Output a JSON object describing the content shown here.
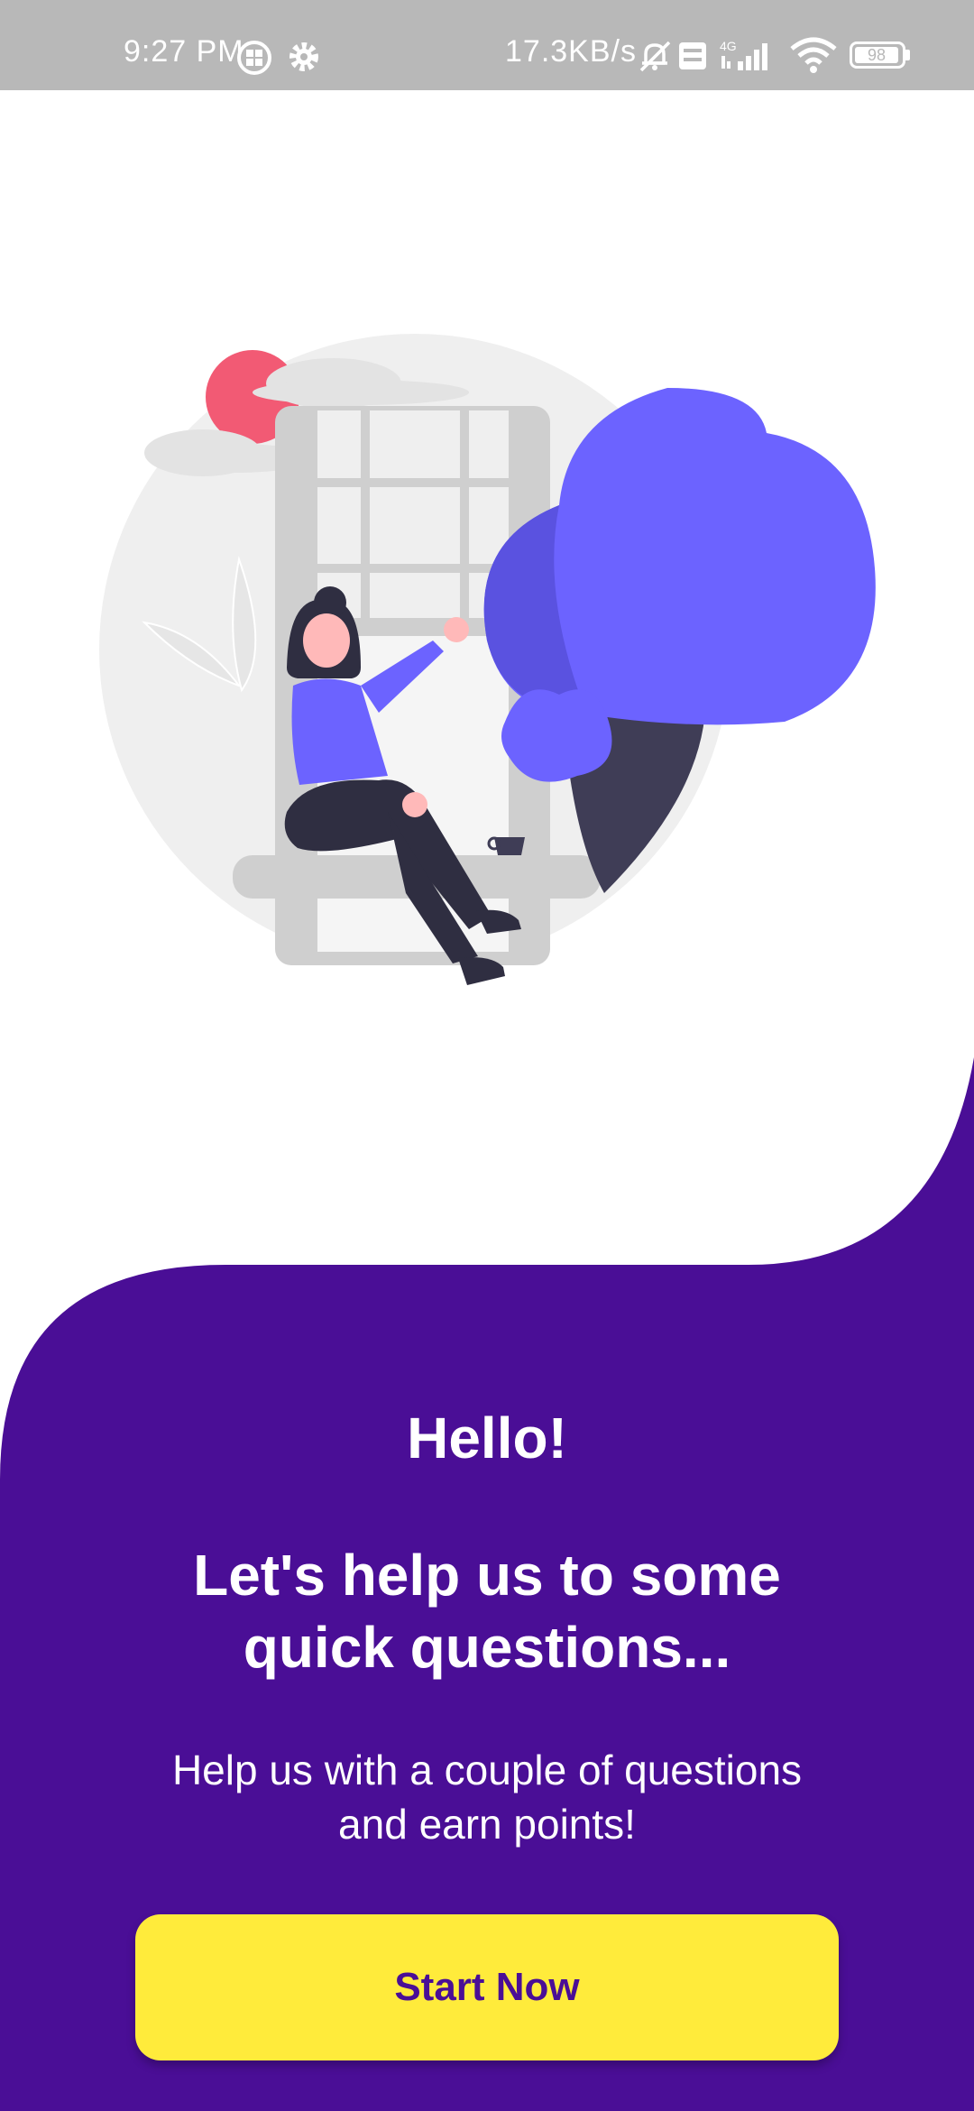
{
  "status_bar": {
    "time": "9:27 PM",
    "network_speed": "17.3KB/s",
    "battery_level": "98",
    "icons": [
      "grid-app-icon",
      "settings-gear-icon",
      "mute-bell-icon",
      "volte-icon",
      "signal-4g-icon",
      "wifi-icon",
      "battery-icon"
    ]
  },
  "intro": {
    "greeting": "Hello!",
    "headline": "Let's help us to some quick questions...",
    "subtitle": "Help us with a couple of questions and earn points!",
    "start_button_label": "Start Now"
  },
  "colors": {
    "primary": "#4a0e96",
    "accent": "#ffeb3b",
    "illustration_purple": "#6c63ff",
    "status_bar": "#b8b8b8"
  }
}
